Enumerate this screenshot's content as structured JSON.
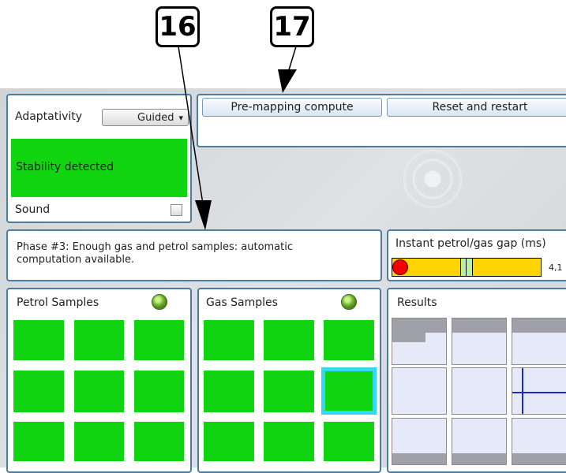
{
  "callouts": {
    "c16": "16",
    "c17": "17"
  },
  "adaptativity": {
    "label": "Adaptativity",
    "selected": "Guided",
    "arrow": "▾"
  },
  "stability": {
    "text": "Stability detected",
    "color": "#10d510"
  },
  "sound": {
    "label": "Sound",
    "checked": false
  },
  "toolbar": {
    "premapping_label": "Pre-mapping compute",
    "reset_label": "Reset and restart"
  },
  "phase": {
    "text": "Phase #3: Enough gas and petrol samples: automatic computation available."
  },
  "gap": {
    "title": "Instant petrol/gas gap (ms)",
    "value": "4,1"
  },
  "petrol": {
    "title": "Petrol Samples",
    "led_icon": "status-led-icon"
  },
  "gas": {
    "title": "Gas Samples",
    "led_icon": "status-led-icon",
    "selected_tile": 6
  },
  "results": {
    "title": "Results"
  },
  "colors": {
    "accent_border": "#4e7ca0",
    "sample_green": "#10d510",
    "selection_cyan": "#33d9f0",
    "gap_bar": "#ffd400"
  }
}
